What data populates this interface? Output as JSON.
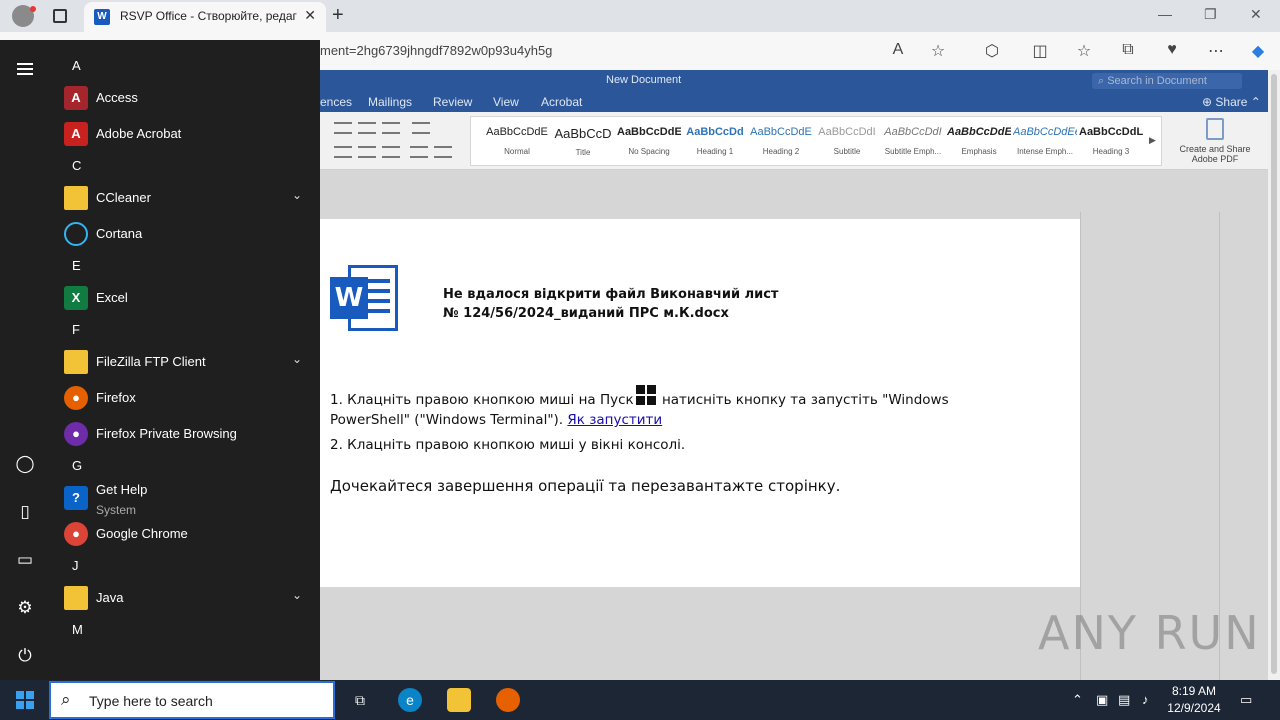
{
  "browser": {
    "tab_title": "RSVP Office - Створюйте, редаг",
    "tab_icon": "W",
    "address_text": "ment=2hg6739jhngdf7892w0p93u4yh5g"
  },
  "word": {
    "doc_title": "New Document",
    "search_placeholder": "Search in Document",
    "menus": [
      "ences",
      "Mailings",
      "Review",
      "View",
      "Acrobat"
    ],
    "share": "Share",
    "styles": [
      {
        "sample": "AaBbCcDdE",
        "name": "Normal"
      },
      {
        "sample": "AaBbCcD",
        "name": "Title"
      },
      {
        "sample": "AaBbCcDdE",
        "name": "No Spacing"
      },
      {
        "sample": "AaBbCcDd",
        "name": "Heading 1"
      },
      {
        "sample": "AaBbCcDdE",
        "name": "Heading 2"
      },
      {
        "sample": "AaBbCcDdI",
        "name": "Subtitle"
      },
      {
        "sample": "AaBbCcDdI",
        "name": "Subtitle Emph..."
      },
      {
        "sample": "AaBbCcDdEe",
        "name": "Emphasis"
      },
      {
        "sample": "AaBbCcDdEe",
        "name": "Intense Emph..."
      },
      {
        "sample": "AaBbCcDdL",
        "name": "Heading 3"
      }
    ],
    "pdf_button": "Create and Share Adobe PDF"
  },
  "document": {
    "heading_line1": "Не вдалося відкрити файл Виконавчий лист",
    "heading_line2": "№ 124/56/2024_виданий ПРС м.К.docx",
    "step1_before": "1. Клацніть правою кнопкою миші на Пуск",
    "step1_after": " натисніть кнопку та запустіть \"Windows PowerShell\" (\"Windows Terminal\"). ",
    "step1_link": "Як запустити",
    "step2": "2. Клацніть правою кнопкою миші у вікні консолі.",
    "wait": "Дочекайтеся завершення операції та перезавантажте сторінку."
  },
  "watermark": "ANY RUN",
  "start_menu": {
    "groups": [
      {
        "letter": "A",
        "apps": [
          {
            "name": "Access",
            "icon": "access-icon",
            "glyph": "A",
            "color": "#a4262c"
          },
          {
            "name": "Adobe Acrobat",
            "icon": "acrobat-icon",
            "glyph": "A",
            "color": "#c7221f"
          }
        ]
      },
      {
        "letter": "C",
        "apps": [
          {
            "name": "CCleaner",
            "icon": "folder-icon",
            "folder": true
          },
          {
            "name": "Cortana",
            "icon": "cortana-icon",
            "glyph": "○",
            "color": "#1f1f1f"
          }
        ]
      },
      {
        "letter": "E",
        "apps": [
          {
            "name": "Excel",
            "icon": "excel-icon",
            "glyph": "X",
            "color": "#107c41"
          }
        ]
      },
      {
        "letter": "F",
        "apps": [
          {
            "name": "FileZilla FTP Client",
            "icon": "folder-icon",
            "folder": true
          },
          {
            "name": "Firefox",
            "icon": "firefox-icon",
            "glyph": "●",
            "color": "#e66000"
          },
          {
            "name": "Firefox Private Browsing",
            "icon": "firefox-private-icon",
            "glyph": "●",
            "color": "#6e2ca8"
          }
        ]
      },
      {
        "letter": "G",
        "apps": [
          {
            "name": "Get Help",
            "sub": "System",
            "icon": "get-help-icon",
            "glyph": "?",
            "color": "#0a64c8"
          },
          {
            "name": "Google Chrome",
            "icon": "chrome-icon",
            "glyph": "●",
            "color": "#db4437"
          }
        ]
      },
      {
        "letter": "J",
        "apps": [
          {
            "name": "Java",
            "icon": "folder-icon",
            "folder": true
          }
        ]
      },
      {
        "letter": "M",
        "apps": []
      }
    ]
  },
  "taskbar": {
    "search_placeholder": "Type here to search",
    "time": "8:19 AM",
    "date": "12/9/2024"
  }
}
